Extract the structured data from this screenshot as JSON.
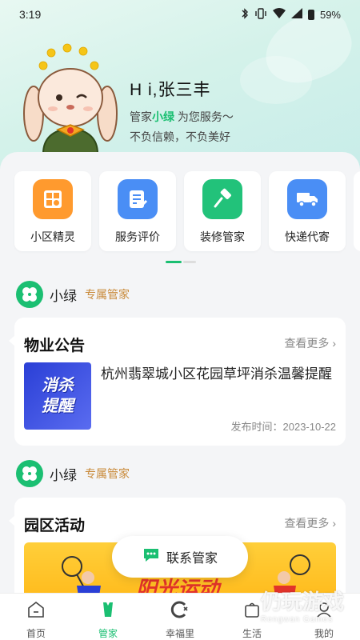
{
  "status": {
    "time": "3:19",
    "battery": "59%"
  },
  "greeting": {
    "hi": "H i,张三丰",
    "prefix": "管家",
    "steward_name": "小绿",
    "suffix": "为您服务～",
    "motto": "不负信赖，不负美好"
  },
  "services": [
    {
      "label": "小区精灵",
      "icon": "community-elf-icon",
      "color": "#ff9a2e"
    },
    {
      "label": "服务评价",
      "icon": "service-review-icon",
      "color": "#4a8ef5"
    },
    {
      "label": "装修管家",
      "icon": "renovation-icon",
      "color": "#22c27a"
    },
    {
      "label": "快递代寄",
      "icon": "delivery-truck-icon",
      "color": "#4a8ef5"
    }
  ],
  "steward_badge": {
    "name": "小绿",
    "role": "专属管家"
  },
  "notice_card": {
    "title": "物业公告",
    "more": "查看更多",
    "image_text": [
      "消杀",
      "提醒"
    ],
    "headline": "杭州翡翠城小区花园草坪消杀温馨提醒",
    "time": "发布时间：2023-10-22"
  },
  "activity_card": {
    "title": "园区活动",
    "more": "查看更多",
    "banner_text": "阳光运动"
  },
  "contact_button": {
    "label": "联系管家"
  },
  "tabs": [
    {
      "label": "首页",
      "icon": "home-icon"
    },
    {
      "label": "管家",
      "icon": "butler-icon",
      "active": true
    },
    {
      "label": "幸福里",
      "icon": "happiness-icon"
    },
    {
      "label": "生活",
      "icon": "life-icon"
    },
    {
      "label": "我的",
      "icon": "profile-icon"
    }
  ],
  "watermark": {
    "cn": "仍玩游戏",
    "en": "Rengwan Games"
  },
  "colors": {
    "accent": "#1bbf72",
    "role": "#c98a3a"
  }
}
